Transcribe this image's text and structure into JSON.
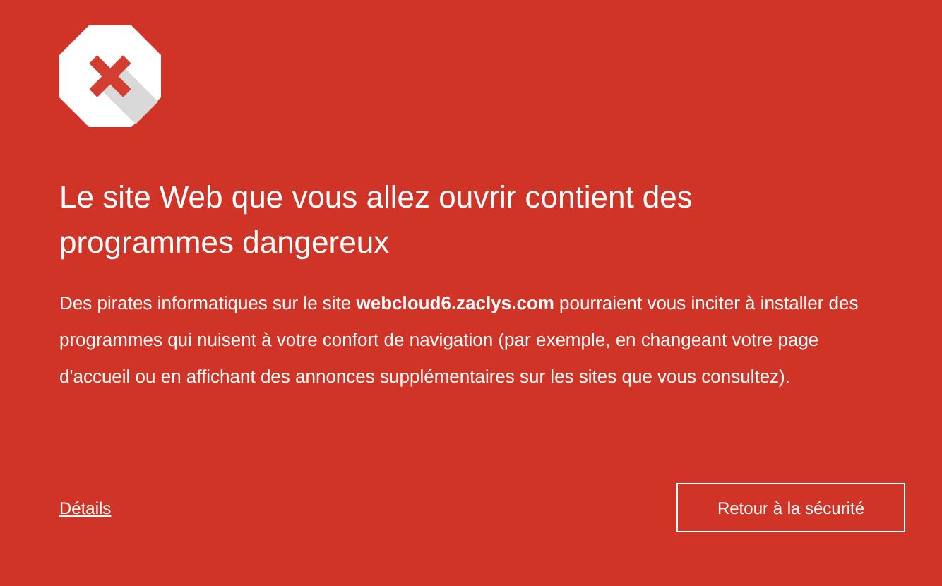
{
  "title": "Le site Web que vous allez ouvrir contient des programmes dangereux",
  "message": "Des pirates informatiques sur le site **webcloud6.zaclys.com** pourraient vous inciter à installer des programmes qui nuisent à votre confort de navigation (par exemple, en changeant votre page d'accueil ou en affichant des annonces supplémentaires sur les sites que vous consultez).",
  "details_link": "Détails",
  "back_button": "Retour à la sécurité"
}
